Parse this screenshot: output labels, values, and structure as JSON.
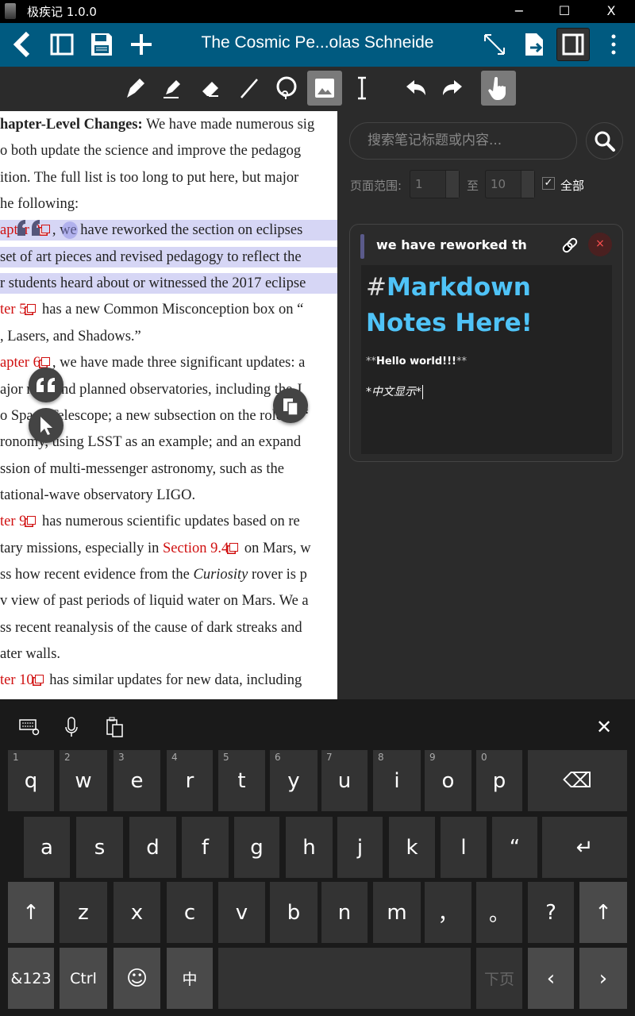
{
  "window": {
    "title": "极疾记 1.0.0",
    "minimize": "−",
    "maximize": "☐",
    "close": "X"
  },
  "appbar": {
    "doc_title": "The Cosmic Pe...olas Schneide"
  },
  "document": {
    "lines": [
      {
        "segs": [
          {
            "t": "hapter-Level Changes:",
            "s": "b"
          },
          {
            "t": " We have made numerous sig"
          }
        ]
      },
      {
        "segs": [
          {
            "t": "o both update the science and improve the pedagog"
          }
        ]
      },
      {
        "segs": [
          {
            "t": "ition. The full list is too long to put here, but major"
          }
        ]
      },
      {
        "segs": [
          {
            "t": "he following:"
          }
        ]
      },
      {
        "hl": true,
        "segs": [
          {
            "t": "apter 2",
            "s": "red",
            "link": true
          },
          {
            "t": ", we have reworked the section on eclipses"
          }
        ]
      },
      {
        "hl": true,
        "segs": [
          {
            "t": "set of art pieces and revised pedagogy to reflect the"
          }
        ]
      },
      {
        "hl": true,
        "segs": [
          {
            "t": "r students heard about or witnessed the 2017 eclipse"
          }
        ]
      },
      {
        "segs": [
          {
            "t": "ter 5",
            "s": "red",
            "link": true
          },
          {
            "t": " has a new Common Misconception box on “"
          }
        ]
      },
      {
        "segs": [
          {
            "t": ", Lasers, and Shadows.”"
          }
        ]
      },
      {
        "segs": [
          {
            "t": "apter 6",
            "s": "red",
            "link": true
          },
          {
            "t": ", we have made three significant updates: a"
          }
        ]
      },
      {
        "segs": [
          {
            "t": "ajor new and planned observatories, including the J"
          }
        ]
      },
      {
        "segs": [
          {
            "t": "o Space Telescope; a new subsection on the role of “"
          }
        ]
      },
      {
        "segs": [
          {
            "t": "ronomy, using LSST as an example; and an expand"
          }
        ]
      },
      {
        "segs": [
          {
            "t": "ssion of multi-messenger astronomy, such as the"
          }
        ]
      },
      {
        "segs": [
          {
            "t": "tational-wave observatory LIGO."
          }
        ]
      },
      {
        "segs": [
          {
            "t": "ter 9",
            "s": "red",
            "link": true
          },
          {
            "t": " has numerous scientific updates based on re"
          }
        ]
      },
      {
        "segs": [
          {
            "t": "tary missions, especially in "
          },
          {
            "t": "Section 9.4",
            "s": "red",
            "link": true
          },
          {
            "t": " on Mars, w"
          }
        ]
      },
      {
        "segs": [
          {
            "t": "ss how recent evidence from the "
          },
          {
            "t": "Curiosity",
            "s": "i"
          },
          {
            "t": " rover is p"
          }
        ]
      },
      {
        "segs": [
          {
            "t": "v view of past periods of liquid water on Mars. We a"
          }
        ]
      },
      {
        "segs": [
          {
            "t": "ss recent reanalysis of the cause of dark streaks and"
          }
        ]
      },
      {
        "segs": [
          {
            "t": "ater walls."
          }
        ]
      },
      {
        "segs": [
          {
            "t": "ter 10",
            "s": "red",
            "link": true
          },
          {
            "t": " has similar updates for new data, including"
          }
        ]
      }
    ]
  },
  "sidebar": {
    "search_placeholder": "搜索笔记标题或内容...",
    "range_label": "页面范围:",
    "range_from": "1",
    "range_to_label": "至",
    "range_to": "10",
    "all_checked": true,
    "all_check_mark": "✓",
    "all_label": "全部",
    "note": {
      "title": "we have reworked the sec",
      "close": "×",
      "md_hash": "#",
      "md_heading": "Markdown Notes Here!",
      "md_bold_mark": "**",
      "md_bold": "Hello world!!!",
      "md_italic": "*中文显示*"
    }
  },
  "keyboard": {
    "rows": [
      [
        {
          "l": "q",
          "n": "1"
        },
        {
          "l": "w",
          "n": "2"
        },
        {
          "l": "e",
          "n": "3"
        },
        {
          "l": "r",
          "n": "4"
        },
        {
          "l": "t",
          "n": "5"
        },
        {
          "l": "y",
          "n": "6"
        },
        {
          "l": "u",
          "n": "7"
        },
        {
          "l": "i",
          "n": "8"
        },
        {
          "l": "o",
          "n": "9"
        },
        {
          "l": "p",
          "n": "0"
        },
        {
          "l": "⌫",
          "name": "backspace"
        }
      ],
      [
        {
          "l": "a"
        },
        {
          "l": "s"
        },
        {
          "l": "d"
        },
        {
          "l": "f"
        },
        {
          "l": "g"
        },
        {
          "l": "h"
        },
        {
          "l": "j"
        },
        {
          "l": "k"
        },
        {
          "l": "l"
        },
        {
          "l": "“"
        },
        {
          "l": "↵",
          "name": "enter"
        }
      ],
      [
        {
          "l": "↑",
          "name": "shift-left"
        },
        {
          "l": "z"
        },
        {
          "l": "x"
        },
        {
          "l": "c"
        },
        {
          "l": "v"
        },
        {
          "l": "b"
        },
        {
          "l": "n"
        },
        {
          "l": "m"
        },
        {
          "l": "，"
        },
        {
          "l": "。"
        },
        {
          "l": "?"
        },
        {
          "l": "↑",
          "name": "shift-right"
        }
      ],
      [
        {
          "l": "&123",
          "name": "symbols"
        },
        {
          "l": "Ctrl",
          "name": "ctrl"
        },
        {
          "l": "☺",
          "name": "emoji"
        },
        {
          "l": "中",
          "name": "language"
        },
        {
          "l": "",
          "name": "space"
        },
        {
          "l": "下页",
          "name": "next-page"
        },
        {
          "l": "‹",
          "name": "left"
        },
        {
          "l": "›",
          "name": "right"
        }
      ]
    ],
    "close": "✕"
  },
  "colors": {
    "appbar": "#005a80",
    "heading": "#4fc3f7",
    "link": "#d01010",
    "highlight": "#d6d6f5"
  }
}
